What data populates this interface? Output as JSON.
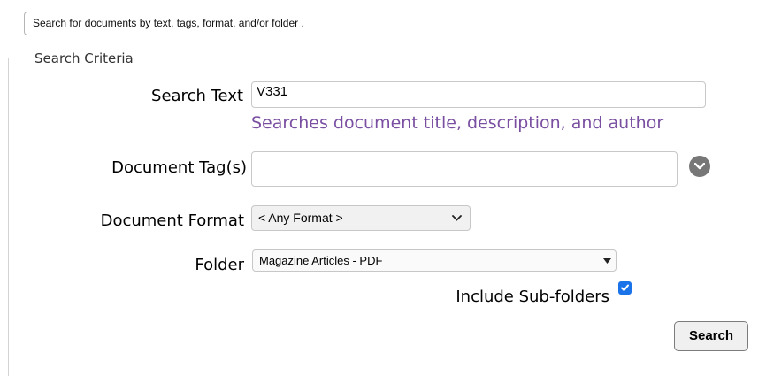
{
  "search_bar": {
    "placeholder": "Search for documents by text, tags, format, and/or folder ."
  },
  "criteria": {
    "legend": "Search Criteria",
    "search_text": {
      "label": "Search Text",
      "value": "V331",
      "hint": "Searches document title, description, and author"
    },
    "document_tags": {
      "label": "Document Tag(s)",
      "value": "",
      "icon": "chevron-down-icon"
    },
    "document_format": {
      "label": "Document Format",
      "selected": "< Any Format >"
    },
    "folder": {
      "label": "Folder",
      "selected": "Magazine Articles - PDF"
    },
    "include_subfolders": {
      "label": "Include Sub-folders",
      "checked": true
    },
    "search_button": "Search"
  },
  "colors": {
    "hint_text": "#7a4fa2",
    "checkbox": "#1a73e8",
    "circle_button": "#777777"
  }
}
